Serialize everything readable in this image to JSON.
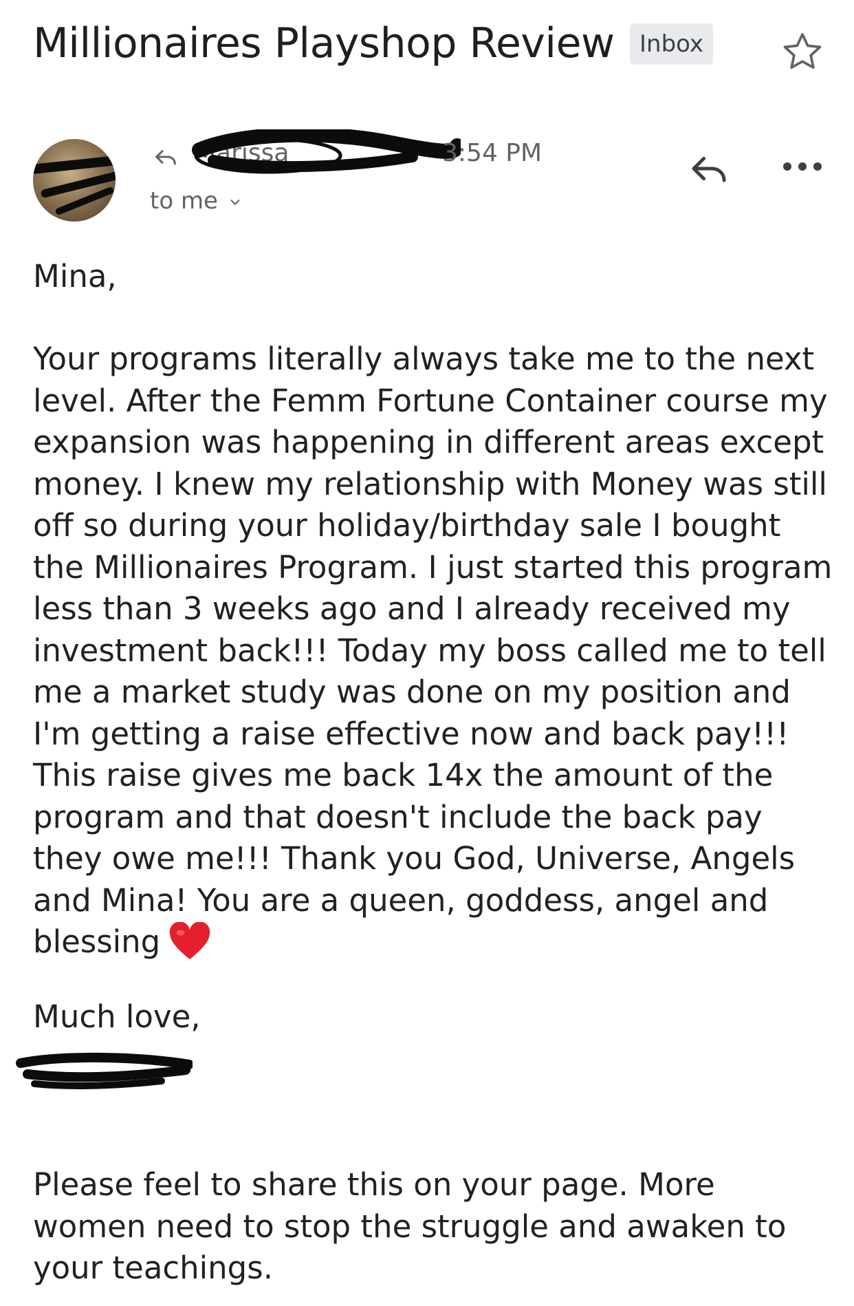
{
  "header": {
    "subject": "Millionaires Playshop Review",
    "badge": "Inbox",
    "star_icon": "star-outline-icon"
  },
  "sender": {
    "name": "Marissa",
    "time": "3:54 PM",
    "recipient_label": "to me",
    "reply_icon": "reply-icon",
    "more_icon": "more-options-icon"
  },
  "message": {
    "greeting": "Mina,",
    "body": "Your programs literally always take me to the next level. After the Femm Fortune Container course my expansion was happening in different areas except money. I knew my relationship with Money was still off so during your holiday/birthday sale I bought the Millionaires Program. I just started this program less than 3 weeks ago and I already received my investment back!!! Today my boss called me to tell me a market study was done on my position and I'm getting a raise effective now and back pay!!! This raise gives me back 14x the amount of the program and that doesn't include the back pay they owe me!!! Thank you God, Universe, Angels and Mina! You are a queen, goddess, angel and blessing",
    "emoji": "heart-emoji",
    "signoff": "Much love,",
    "closing": "Please feel to share this on your page. More women need to stop the struggle and awaken to your teachings."
  },
  "colors": {
    "text": "#202124",
    "muted": "#5f6368",
    "badge_bg": "#e8eaed",
    "heart": "#e5202e",
    "redaction": "#0c0c0c"
  }
}
